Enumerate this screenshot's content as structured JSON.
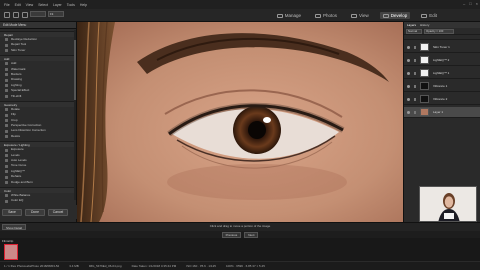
{
  "menu": [
    "File",
    "Edit",
    "View",
    "Select",
    "Layer",
    "Tools",
    "Help"
  ],
  "toolbar": {
    "zoom_value": "Fit"
  },
  "modes": [
    {
      "label": "Manage",
      "active": false
    },
    {
      "label": "Photos",
      "active": false
    },
    {
      "label": "View",
      "active": false
    },
    {
      "label": "Develop",
      "active": true
    },
    {
      "label": "Edit",
      "active": false
    }
  ],
  "window_controls": [
    "–",
    "□",
    "×"
  ],
  "left_panel": {
    "title": "Edit Mode Menu",
    "sections": [
      {
        "heading": "Repair",
        "items": [
          "Red-Eye Reduction",
          "Repair Tool",
          "Skin Tuner"
        ]
      },
      {
        "heading": "Add",
        "items": [
          "Add",
          "Watermark",
          "Borders",
          "Drawing",
          "Lighting",
          "Special Effect",
          "Tilt-shift"
        ]
      },
      {
        "heading": "Geometry",
        "items": [
          "Rotate",
          "Flip",
          "Crop",
          "Perspective Correction",
          "Lens Distortion Correction",
          "Resize"
        ]
      },
      {
        "heading": "Exposure / Lighting",
        "items": [
          "Exposure",
          "Levels",
          "Auto Levels",
          "Tone Curve",
          "LightEQ™",
          "Dehaze",
          "Dodge and Burn"
        ]
      },
      {
        "heading": "Color",
        "items": [
          "White Balance",
          "Color EQ",
          "Color Balance"
        ]
      }
    ],
    "buttons": {
      "save": "Save",
      "done": "Done",
      "cancel": "Cancel"
    }
  },
  "right_panel": {
    "tabs": [
      "Layers",
      "History"
    ],
    "blend_mode": "Normal",
    "opacity_label": "Opacity = 100",
    "layers": [
      {
        "name": "Skin Tuner 1",
        "thumb": "white",
        "selected": false
      },
      {
        "name": "LightEQ™ 2",
        "thumb": "white",
        "selected": false
      },
      {
        "name": "LightEQ™ 1",
        "thumb": "white",
        "selected": false
      },
      {
        "name": "Vibrance 1",
        "thumb": "dark",
        "selected": false
      },
      {
        "name": "Vibrance 2",
        "thumb": "dark",
        "selected": false
      },
      {
        "name": "Layer 1",
        "thumb": "photo",
        "selected": true
      }
    ]
  },
  "navbar": {
    "show_detail": "Show Detail",
    "hint": "Click and drag to move a portion of the image",
    "previous": "Previous",
    "next": "Next"
  },
  "filmstrip": {
    "label": "Filmstrip"
  },
  "status": [
    "1 / 1 files  PhotoLabsPhoto 2018/08/03-52",
    "3.4 MB",
    "IMG_5476Ed_06-04.png",
    "Date Taken: 1/1/2018 4:35:44 PM",
    "ISO 160 · f/5.6 · 1/125",
    "100% · 6596 · 6.85 37 × 5.45"
  ]
}
